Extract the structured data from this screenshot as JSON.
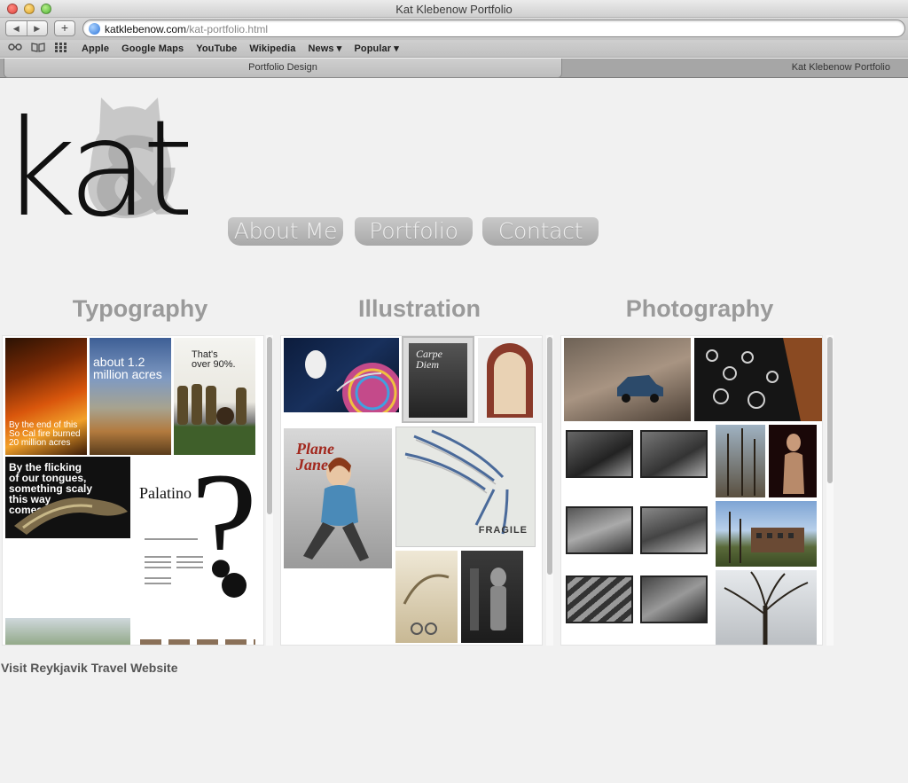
{
  "window": {
    "title": "Kat Klebenow Portfolio"
  },
  "toolbar": {
    "back": "◀",
    "forward": "▶",
    "add": "+",
    "url_host": "katklebenow.com",
    "url_path": "/kat-portfolio.html"
  },
  "bookmarks": {
    "items": [
      "Apple",
      "Google Maps",
      "YouTube",
      "Wikipedia",
      "News ▾",
      "Popular ▾"
    ]
  },
  "tabs": {
    "active": "Portfolio Design",
    "other": "Kat Klebenow Portfolio"
  },
  "logo": {
    "text": "kat"
  },
  "nav": {
    "about": "About Me",
    "portfolio": "Portfolio",
    "contact": "Contact"
  },
  "columns": {
    "typography": {
      "title": "Typography",
      "captions": {
        "fire": "By the end of this\nSo Cal fire burned\n20 million acres",
        "acres": "about 1.2\nmillion acres",
        "percent": "That's\nover 90%.",
        "snake": "By the flicking\nof our tongues,\nsomething scaly\nthis way\ncomes",
        "palatino": "Palatino",
        "qmark": "?"
      }
    },
    "illustration": {
      "title": "Illustration",
      "captions": {
        "plane": "Plane\nJane",
        "carpe": "Carpe\nDiem",
        "fragile": "FRAGILE"
      }
    },
    "photography": {
      "title": "Photography"
    }
  },
  "footer": {
    "link": "Visit Reykjavik Travel Website"
  }
}
